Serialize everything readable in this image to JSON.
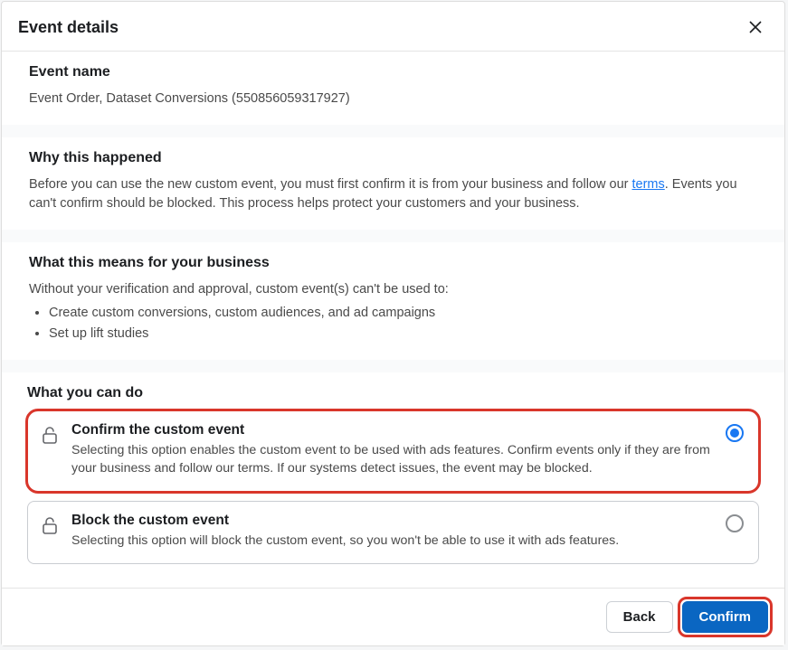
{
  "modal": {
    "title": "Event details"
  },
  "event_name_section": {
    "title": "Event name",
    "value": "Event Order, Dataset Conversions (550856059317927)"
  },
  "why_section": {
    "title": "Why this happened",
    "text_before": "Before you can use the new custom event, you must first confirm it is from your business and follow our ",
    "link_text": "terms",
    "text_after": ". Events you can't confirm should be blocked. This process helps protect your customers and your business."
  },
  "means_section": {
    "title": "What this means for your business",
    "intro": "Without your verification and approval, custom event(s) can't be used to:",
    "bullets": [
      "Create custom conversions, custom audiences, and ad campaigns",
      "Set up lift studies"
    ]
  },
  "action_section": {
    "title": "What you can do",
    "options": [
      {
        "title": "Confirm the custom event",
        "desc": "Selecting this option enables the custom event to be used with ads features. Confirm events only if they are from your business and follow our terms. If our systems detect issues, the event may be blocked.",
        "selected": true
      },
      {
        "title": "Block the custom event",
        "desc": "Selecting this option will block the custom event, so you won't be able to use it with ads features.",
        "selected": false
      }
    ]
  },
  "footer": {
    "back": "Back",
    "confirm": "Confirm"
  }
}
